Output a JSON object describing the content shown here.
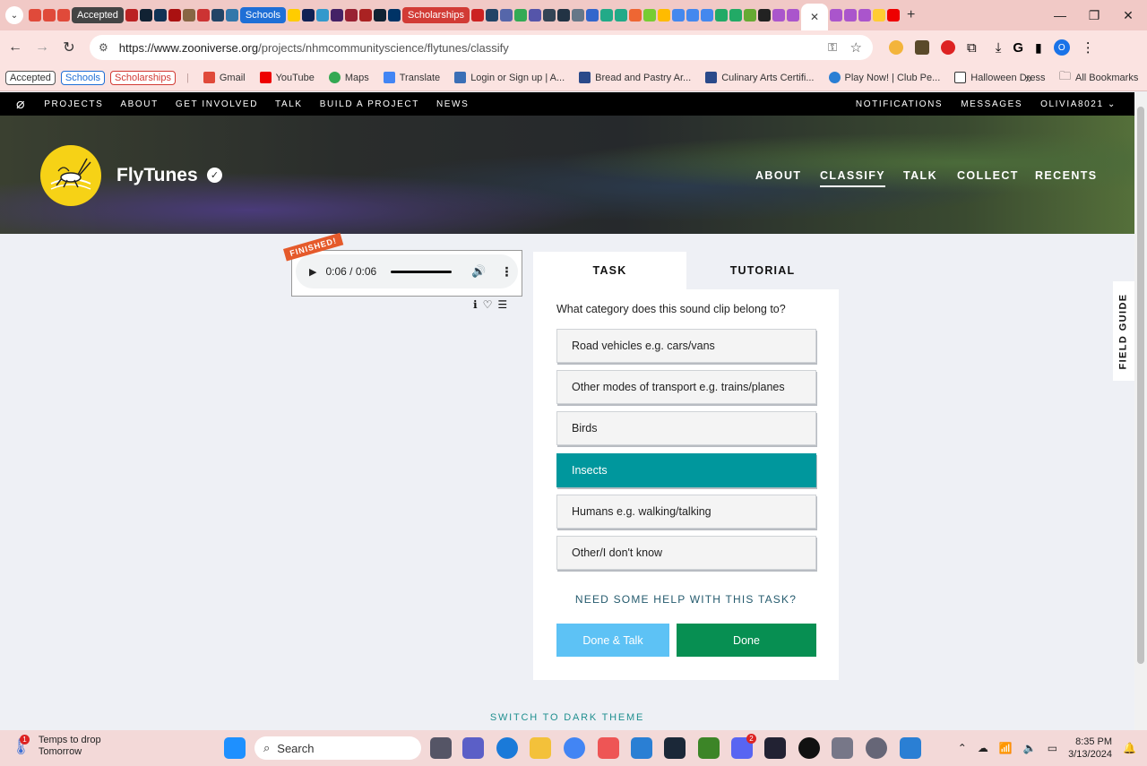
{
  "browser": {
    "tab_pills": [
      "Accepted",
      "Schools",
      "Scholarships"
    ],
    "url_domain": "https://www.zooniverse.org",
    "url_path": "/projects/nhmcommunityscience/flytunes/classify",
    "profile_initial": "O",
    "window_controls": [
      "minimize-icon",
      "restore-icon",
      "close-icon"
    ]
  },
  "bookmarks": {
    "chips": [
      "Accepted",
      "Schools",
      "Scholarships"
    ],
    "items": [
      "Gmail",
      "YouTube",
      "Maps",
      "Translate",
      "Login or Sign up | A...",
      "Bread and Pastry Ar...",
      "Culinary Arts Certifi...",
      "Play Now! | Club Pe...",
      "Halloween Dress"
    ],
    "all_bookmarks": "All Bookmarks",
    "overflow": "»"
  },
  "zoo_nav": {
    "left": [
      "PROJECTS",
      "ABOUT",
      "GET INVOLVED",
      "TALK",
      "BUILD A PROJECT",
      "NEWS"
    ],
    "right": [
      "NOTIFICATIONS",
      "MESSAGES",
      "OLIVIA8021"
    ]
  },
  "project": {
    "title": "FlyTunes",
    "nav": [
      "ABOUT",
      "CLASSIFY",
      "TALK",
      "COLLECT",
      "RECENTS"
    ],
    "active_nav": "CLASSIFY"
  },
  "audio": {
    "badge": "FINISHED!",
    "time": "0:06 / 0:06",
    "progress": 1.0
  },
  "task": {
    "tabs": [
      "TASK",
      "TUTORIAL"
    ],
    "question": "What category does this sound clip belong to?",
    "answers": [
      "Road vehicles e.g. cars/vans",
      "Other modes of transport e.g. trains/planes",
      "Birds",
      "Insects",
      "Humans e.g. walking/talking",
      "Other/I don't know"
    ],
    "selected_index": 3,
    "help_link": "NEED SOME HELP WITH THIS TASK?",
    "done_talk": "Done & Talk",
    "done": "Done"
  },
  "field_guide": "FIELD GUIDE",
  "dark_theme": "SWITCH TO DARK THEME",
  "colors": {
    "selected": "#00979d",
    "done": "#078f52",
    "done_talk": "#5dc2f5",
    "logo": "#f6d216"
  },
  "taskbar": {
    "weather_title": "Temps to drop",
    "weather_sub": "Tomorrow",
    "weather_badge": "1",
    "search_placeholder": "Search",
    "discord_badge": "2",
    "time": "8:35 PM",
    "date": "3/13/2024"
  }
}
